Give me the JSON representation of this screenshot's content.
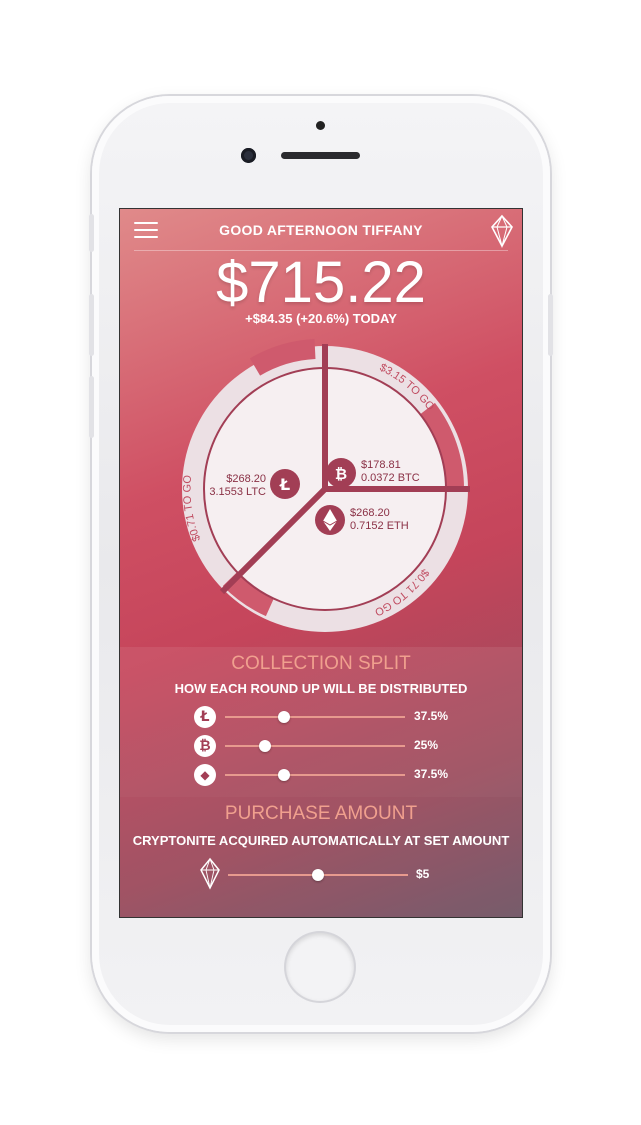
{
  "header": {
    "greeting": "GOOD AFTERNOON TIFFANY"
  },
  "portfolio": {
    "balance": "$715.22",
    "change": "+$84.35 (+20.6%) TODAY"
  },
  "holdings": [
    {
      "coin": "LTC",
      "icon": "litecoin-icon",
      "value": "$268.20",
      "amount": "3.1553 LTC"
    },
    {
      "coin": "BTC",
      "icon": "bitcoin-icon",
      "value": "$178.81",
      "amount": "0.0372 BTC"
    },
    {
      "coin": "ETH",
      "icon": "ethereum-icon",
      "value": "$268.20",
      "amount": "0.7152 ETH"
    }
  ],
  "to_go": {
    "ltc": "$0.71 TO GO",
    "btc": "$3.15 TO GO",
    "eth": "$0.71 TO GO"
  },
  "collection_split": {
    "title": "COLLECTION SPLIT",
    "subtitle": "HOW EACH ROUND UP WILL BE DISTRIBUTED",
    "rows": [
      {
        "coin": "LTC",
        "icon": "litecoin-icon",
        "glyph": "Ł",
        "percent": "37.5%",
        "level": 0.33
      },
      {
        "coin": "BTC",
        "icon": "bitcoin-icon",
        "glyph": "₿",
        "percent": "25%",
        "level": 0.22
      },
      {
        "coin": "ETH",
        "icon": "ethereum-icon",
        "glyph": "◆",
        "percent": "37.5%",
        "level": 0.33
      }
    ]
  },
  "purchase_amount": {
    "title": "PURCHASE AMOUNT",
    "subtitle": "CRYPTONITE ACQUIRED AUTOMATICALLY AT SET AMOUNT",
    "value": "$5",
    "level": 0.5
  },
  "colors": {
    "accent": "#f0a08e",
    "coin": "#a23e55",
    "ring": "#f1e6ea"
  }
}
